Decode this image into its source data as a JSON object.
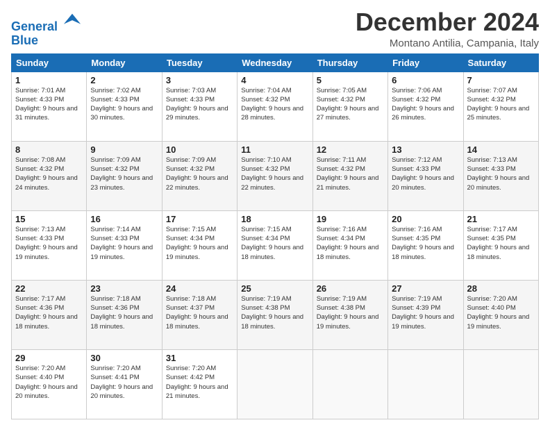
{
  "logo": {
    "line1": "General",
    "line2": "Blue"
  },
  "title": "December 2024",
  "location": "Montano Antilia, Campania, Italy",
  "days_of_week": [
    "Sunday",
    "Monday",
    "Tuesday",
    "Wednesday",
    "Thursday",
    "Friday",
    "Saturday"
  ],
  "weeks": [
    [
      {
        "day": "1",
        "sunrise": "7:01 AM",
        "sunset": "4:33 PM",
        "daylight": "9 hours and 31 minutes."
      },
      {
        "day": "2",
        "sunrise": "7:02 AM",
        "sunset": "4:33 PM",
        "daylight": "9 hours and 30 minutes."
      },
      {
        "day": "3",
        "sunrise": "7:03 AM",
        "sunset": "4:33 PM",
        "daylight": "9 hours and 29 minutes."
      },
      {
        "day": "4",
        "sunrise": "7:04 AM",
        "sunset": "4:32 PM",
        "daylight": "9 hours and 28 minutes."
      },
      {
        "day": "5",
        "sunrise": "7:05 AM",
        "sunset": "4:32 PM",
        "daylight": "9 hours and 27 minutes."
      },
      {
        "day": "6",
        "sunrise": "7:06 AM",
        "sunset": "4:32 PM",
        "daylight": "9 hours and 26 minutes."
      },
      {
        "day": "7",
        "sunrise": "7:07 AM",
        "sunset": "4:32 PM",
        "daylight": "9 hours and 25 minutes."
      }
    ],
    [
      {
        "day": "8",
        "sunrise": "7:08 AM",
        "sunset": "4:32 PM",
        "daylight": "9 hours and 24 minutes."
      },
      {
        "day": "9",
        "sunrise": "7:09 AM",
        "sunset": "4:32 PM",
        "daylight": "9 hours and 23 minutes."
      },
      {
        "day": "10",
        "sunrise": "7:09 AM",
        "sunset": "4:32 PM",
        "daylight": "9 hours and 22 minutes."
      },
      {
        "day": "11",
        "sunrise": "7:10 AM",
        "sunset": "4:32 PM",
        "daylight": "9 hours and 22 minutes."
      },
      {
        "day": "12",
        "sunrise": "7:11 AM",
        "sunset": "4:32 PM",
        "daylight": "9 hours and 21 minutes."
      },
      {
        "day": "13",
        "sunrise": "7:12 AM",
        "sunset": "4:33 PM",
        "daylight": "9 hours and 20 minutes."
      },
      {
        "day": "14",
        "sunrise": "7:13 AM",
        "sunset": "4:33 PM",
        "daylight": "9 hours and 20 minutes."
      }
    ],
    [
      {
        "day": "15",
        "sunrise": "7:13 AM",
        "sunset": "4:33 PM",
        "daylight": "9 hours and 19 minutes."
      },
      {
        "day": "16",
        "sunrise": "7:14 AM",
        "sunset": "4:33 PM",
        "daylight": "9 hours and 19 minutes."
      },
      {
        "day": "17",
        "sunrise": "7:15 AM",
        "sunset": "4:34 PM",
        "daylight": "9 hours and 19 minutes."
      },
      {
        "day": "18",
        "sunrise": "7:15 AM",
        "sunset": "4:34 PM",
        "daylight": "9 hours and 18 minutes."
      },
      {
        "day": "19",
        "sunrise": "7:16 AM",
        "sunset": "4:34 PM",
        "daylight": "9 hours and 18 minutes."
      },
      {
        "day": "20",
        "sunrise": "7:16 AM",
        "sunset": "4:35 PM",
        "daylight": "9 hours and 18 minutes."
      },
      {
        "day": "21",
        "sunrise": "7:17 AM",
        "sunset": "4:35 PM",
        "daylight": "9 hours and 18 minutes."
      }
    ],
    [
      {
        "day": "22",
        "sunrise": "7:17 AM",
        "sunset": "4:36 PM",
        "daylight": "9 hours and 18 minutes."
      },
      {
        "day": "23",
        "sunrise": "7:18 AM",
        "sunset": "4:36 PM",
        "daylight": "9 hours and 18 minutes."
      },
      {
        "day": "24",
        "sunrise": "7:18 AM",
        "sunset": "4:37 PM",
        "daylight": "9 hours and 18 minutes."
      },
      {
        "day": "25",
        "sunrise": "7:19 AM",
        "sunset": "4:38 PM",
        "daylight": "9 hours and 18 minutes."
      },
      {
        "day": "26",
        "sunrise": "7:19 AM",
        "sunset": "4:38 PM",
        "daylight": "9 hours and 19 minutes."
      },
      {
        "day": "27",
        "sunrise": "7:19 AM",
        "sunset": "4:39 PM",
        "daylight": "9 hours and 19 minutes."
      },
      {
        "day": "28",
        "sunrise": "7:20 AM",
        "sunset": "4:40 PM",
        "daylight": "9 hours and 19 minutes."
      }
    ],
    [
      {
        "day": "29",
        "sunrise": "7:20 AM",
        "sunset": "4:40 PM",
        "daylight": "9 hours and 20 minutes."
      },
      {
        "day": "30",
        "sunrise": "7:20 AM",
        "sunset": "4:41 PM",
        "daylight": "9 hours and 20 minutes."
      },
      {
        "day": "31",
        "sunrise": "7:20 AM",
        "sunset": "4:42 PM",
        "daylight": "9 hours and 21 minutes."
      },
      null,
      null,
      null,
      null
    ]
  ]
}
